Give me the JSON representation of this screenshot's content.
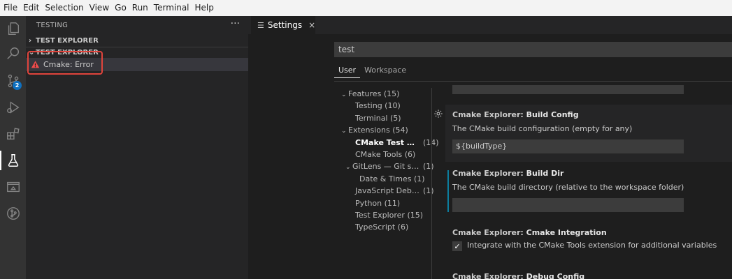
{
  "menu": [
    "File",
    "Edit",
    "Selection",
    "View",
    "Go",
    "Run",
    "Terminal",
    "Help"
  ],
  "activity": {
    "items": [
      "files-icon",
      "search-icon",
      "source-control-icon",
      "run-debug-icon",
      "extensions-icon",
      "testing-icon",
      "remote-explorer-icon",
      "git-graph-icon"
    ],
    "scm_badge": "2"
  },
  "sidebar": {
    "title": "TESTING",
    "more": "···",
    "sections": [
      {
        "label": "TEST EXPLORER",
        "expanded": false
      },
      {
        "label": "TEST EXPLORER",
        "expanded": true
      }
    ],
    "tree_item": "Cmake: Error"
  },
  "tab": {
    "icon": "☰",
    "label": "Settings",
    "close": "×"
  },
  "search": {
    "value": "test"
  },
  "scopes": {
    "user": "User",
    "workspace": "Workspace"
  },
  "toc": [
    {
      "name": "Features",
      "count": "(15)",
      "level": 0,
      "chevron": true
    },
    {
      "name": "Testing",
      "count": "(10)",
      "level": 1
    },
    {
      "name": "Terminal",
      "count": "(5)",
      "level": 1
    },
    {
      "name": "Extensions",
      "count": "(54)",
      "level": 0,
      "chevron": true
    },
    {
      "name": "CMake Test …",
      "count": "(14)",
      "level": 1,
      "bold": true
    },
    {
      "name": "CMake Tools",
      "count": "(6)",
      "level": 1
    },
    {
      "name": "GitLens — Git s…",
      "count": "(1)",
      "level": 1,
      "chevron": true
    },
    {
      "name": "Date & Times",
      "count": "(1)",
      "level": 2
    },
    {
      "name": "JavaScript Deb…",
      "count": "(1)",
      "level": 1
    },
    {
      "name": "Python",
      "count": "(11)",
      "level": 1
    },
    {
      "name": "Test Explorer",
      "count": "(15)",
      "level": 1
    },
    {
      "name": "TypeScript",
      "count": "(6)",
      "level": 1
    }
  ],
  "settings": {
    "build_config": {
      "category": "Cmake Explorer: ",
      "name": "Build Config",
      "description": "The CMake build configuration (empty for any)",
      "value": "${buildType}"
    },
    "build_dir": {
      "category": "Cmake Explorer: ",
      "name": "Build Dir",
      "description": "The CMake build directory (relative to the workspace folder)",
      "value": ""
    },
    "cmake_integration": {
      "category": "Cmake Explorer: ",
      "name": "Cmake Integration",
      "checkbox_label": "Integrate with the CMake Tools extension for additional variables",
      "checked": true
    },
    "debug_config": {
      "category": "Cmake Explorer: ",
      "name": "Debug Config"
    }
  }
}
